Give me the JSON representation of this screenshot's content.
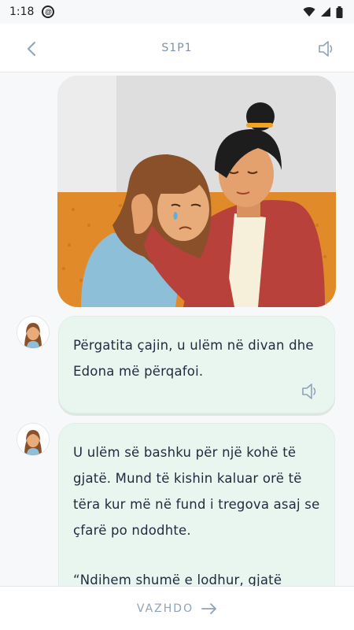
{
  "status_bar": {
    "time": "1:18",
    "icons": [
      "at-sign-icon",
      "wifi-icon",
      "signal-icon",
      "battery-icon"
    ]
  },
  "header": {
    "title": "S1P1",
    "back_icon": "chevron-left-icon",
    "sound_icon": "speaker-icon"
  },
  "messages": [
    {
      "avatar": "woman-avatar",
      "text": "Përgatita çajin, u ulëm në divan dhe Edona më përqafoi.",
      "speaker_icon": "speaker-icon"
    },
    {
      "avatar": "woman-avatar",
      "text": "U ulëm së bashku për një kohë të gjatë. Mund të kishin kaluar orë të tëra kur më në fund i tregova asaj se çfarë po ndodhte.",
      "text2": "“Ndihem shumë e lodhur, gjatë gjithë"
    }
  ],
  "footer": {
    "continue_label": "VAZHDO",
    "arrow_icon": "arrow-right-icon"
  },
  "colors": {
    "accent": "#8ea2b8",
    "bubble": "#e9f6ef",
    "sofa": "#e08a2a"
  }
}
